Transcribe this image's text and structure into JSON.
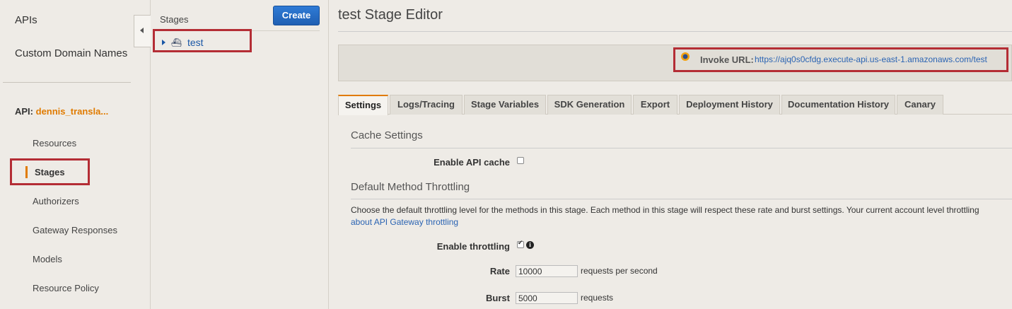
{
  "leftnav": {
    "apis": "APIs",
    "custom_domains": "Custom Domain Names",
    "api_prefix": "API:",
    "api_name": "dennis_transla...",
    "items": [
      {
        "label": "Resources"
      },
      {
        "label": "Stages"
      },
      {
        "label": "Authorizers"
      },
      {
        "label": "Gateway Responses"
      },
      {
        "label": "Models"
      },
      {
        "label": "Resource Policy"
      }
    ]
  },
  "stages": {
    "title": "Stages",
    "create_label": "Create",
    "tree": [
      {
        "label": "test"
      }
    ]
  },
  "main": {
    "title": "test Stage Editor",
    "invoke_label": "Invoke URL:",
    "invoke_url": "https://ajq0s0cfdg.execute-api.us-east-1.amazonaws.com/test",
    "tabs": [
      {
        "label": "Settings"
      },
      {
        "label": "Logs/Tracing"
      },
      {
        "label": "Stage Variables"
      },
      {
        "label": "SDK Generation"
      },
      {
        "label": "Export"
      },
      {
        "label": "Deployment History"
      },
      {
        "label": "Documentation History"
      },
      {
        "label": "Canary"
      }
    ],
    "cache": {
      "section_title": "Cache Settings",
      "enable_label": "Enable API cache",
      "enabled": false
    },
    "throttling": {
      "section_title": "Default Method Throttling",
      "description": "Choose the default throttling level for the methods in this stage. Each method in this stage will respect these rate and burst settings. Your current account level throttling",
      "link_text": "about API Gateway throttling",
      "enable_label": "Enable throttling",
      "enabled": true,
      "rate_label": "Rate",
      "rate_value": "10000",
      "rate_unit": "requests per second",
      "burst_label": "Burst",
      "burst_value": "5000",
      "burst_unit": "requests"
    }
  },
  "colors": {
    "accent": "#e07b00",
    "link": "#2b64b3",
    "highlight": "#b42d35",
    "primary_button": "#1f5fb3"
  }
}
